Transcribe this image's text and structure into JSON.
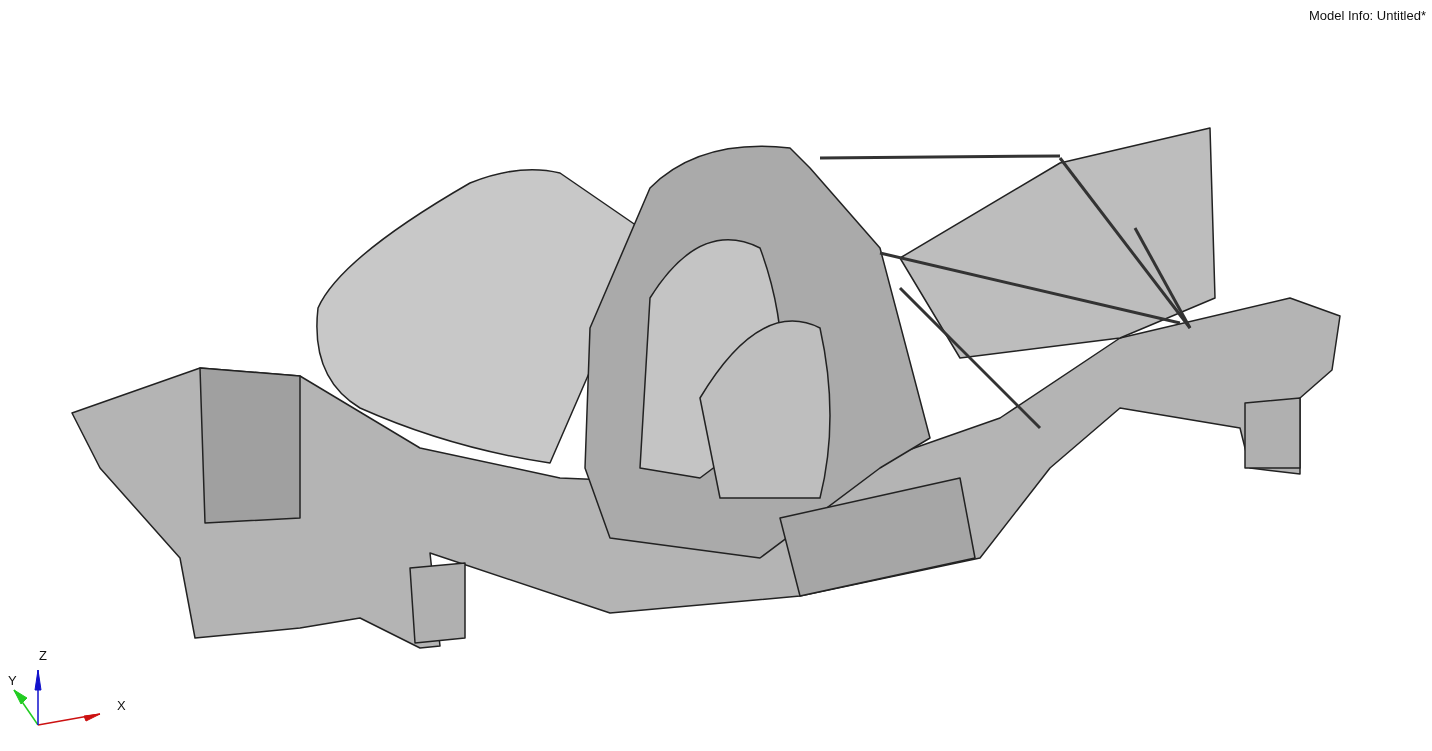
{
  "model_info": "Model Info: Untitled*",
  "triad": {
    "axes": [
      {
        "label": "X",
        "color": "#cc1111"
      },
      {
        "label": "Y",
        "color": "#22cc22"
      },
      {
        "label": "Z",
        "color": "#1111cc"
      }
    ]
  }
}
